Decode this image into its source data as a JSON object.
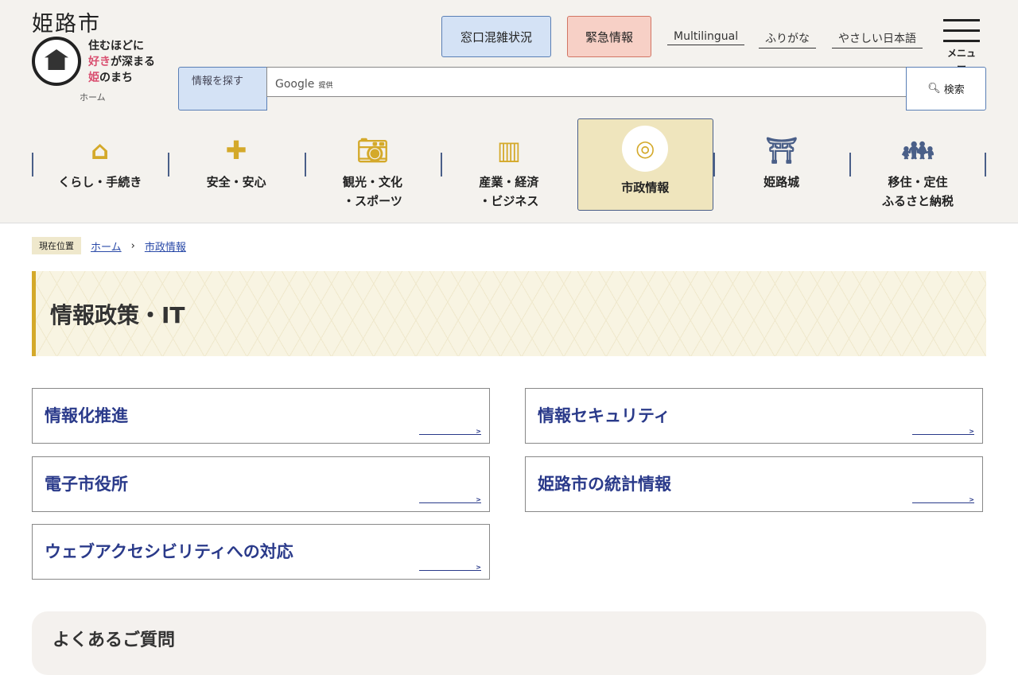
{
  "header": {
    "site_name": "姫路市",
    "tagline": [
      "住むほどに",
      "好き",
      "が深まる",
      "姫",
      "のまち"
    ],
    "home_label": "ホーム",
    "crowd_button": "窓口混雑状況",
    "emergency_button": "緊急情報",
    "links": [
      "Multilingual",
      "ふりがな",
      "やさしい日本語"
    ],
    "menu_label": "メニュー",
    "search": {
      "label": "情報を探す",
      "google": "Google",
      "provided": "提供",
      "button": "検索"
    }
  },
  "nav": [
    {
      "label": "くらし・手続き",
      "icon": "house-icon"
    },
    {
      "label": "安全・安心",
      "icon": "cross-icon"
    },
    {
      "label": "観光・文化\n・スポーツ",
      "icon": "camera-icon"
    },
    {
      "label": "産業・経済\n・ビジネス",
      "icon": "building-icon"
    },
    {
      "label": "市政情報",
      "icon": "city-emblem-icon",
      "active": true
    },
    {
      "label": "姫路城",
      "icon": "castle-icon"
    },
    {
      "label": "移住・定住\nふるさと納税",
      "icon": "family-icon"
    }
  ],
  "breadcrumb": {
    "current_label": "現在位置",
    "items": [
      "ホーム",
      "市政情報"
    ]
  },
  "page_title": "情報政策・IT",
  "cards": [
    "情報化推進",
    "情報セキュリティ",
    "電子市役所",
    "姫路市の統計情報",
    "ウェブアクセシビリティへの対応"
  ],
  "faq_title": "よくあるご質問"
}
